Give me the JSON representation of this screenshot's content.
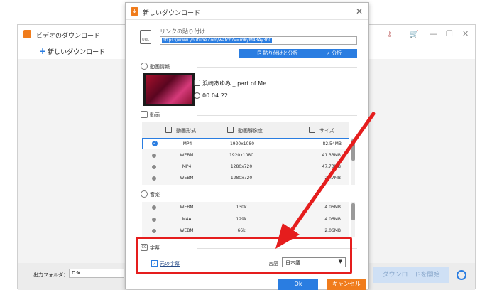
{
  "bg_app": {
    "title": "ビデオのダウンロード",
    "new_download_label": "新しいダウンロード",
    "output_folder_label": "出力フォルダ：",
    "output_folder_value": "D:¥",
    "download_button_label": "ダウンロードを開始",
    "minimize_glyph": "—",
    "restore_glyph": "❐",
    "close_glyph": "✕",
    "key_icon_glyph": "⚷",
    "cart_icon_glyph": "🛒"
  },
  "dialog": {
    "title": "新しいダウンロード",
    "close_glyph": "✕",
    "paste_section_label": "リンクの貼り付け",
    "paste_icon_text": "URL",
    "url_value": "https://www.youtube.com/watch?v=mKyM43Ay3h0",
    "paste_and_analyze_label": "貼り付けと分析",
    "analyze_label": "分析",
    "video_info_title": "動画情報",
    "video_name": "浜崎あゆみ _ part of Me",
    "video_duration": "00:04:22",
    "video_section_title": "動画",
    "columns": {
      "format": "動画形式",
      "resolution": "動画解像度",
      "size": "サイズ"
    },
    "video_rows": [
      {
        "format": "MP4",
        "resolution": "1920x1080",
        "size": "82.54MB",
        "selected": true
      },
      {
        "format": "WEBM",
        "resolution": "1920x1080",
        "size": "41.33MB",
        "selected": false
      },
      {
        "format": "MP4",
        "resolution": "1280x720",
        "size": "47.73MB",
        "selected": false
      },
      {
        "format": "WEBM",
        "resolution": "1280x720",
        "size": "23.7MB",
        "selected": false
      }
    ],
    "audio_section_title": "音楽",
    "audio_rows": [
      {
        "format": "WEBM",
        "bitrate": "130k",
        "size": "4.06MB"
      },
      {
        "format": "M4A",
        "bitrate": "129k",
        "size": "4.06MB"
      },
      {
        "format": "WEBM",
        "bitrate": "66k",
        "size": "2.06MB"
      }
    ],
    "subtitle_section_title": "字幕",
    "original_subtitle_label": "元の字幕",
    "original_subtitle_checked": true,
    "language_label": "言語",
    "language_value": "日本語",
    "ok_label": "Ok",
    "cancel_label": "キャンセル"
  },
  "colors": {
    "accent_blue": "#2a7de1",
    "accent_orange": "#f07c1c",
    "annotation_red": "#e51d1d"
  }
}
